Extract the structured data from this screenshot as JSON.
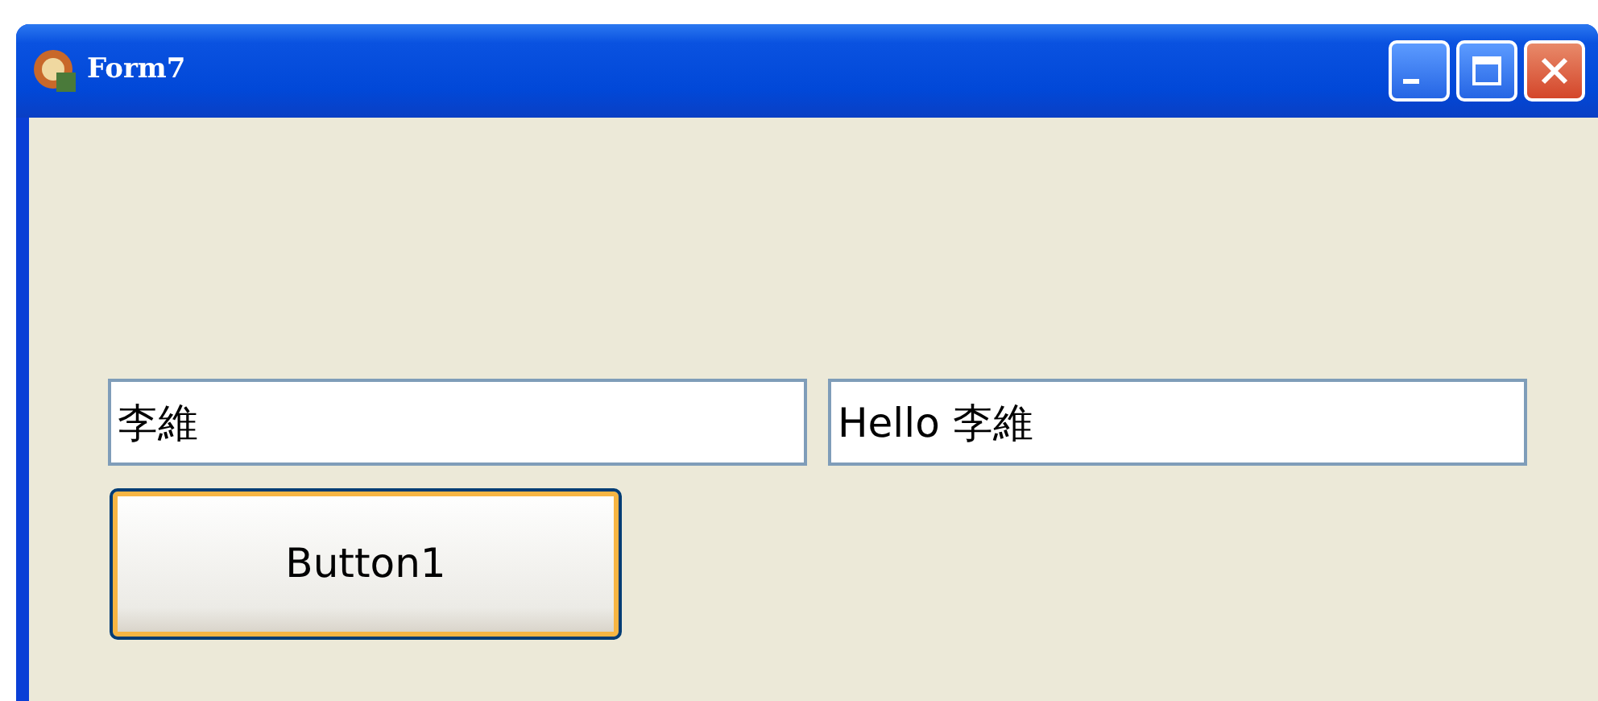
{
  "window": {
    "title": "Form7"
  },
  "fields": [
    {
      "value": "李維"
    },
    {
      "value": "Hello 李維"
    }
  ],
  "button": {
    "label": "Button1",
    "focused": true
  }
}
